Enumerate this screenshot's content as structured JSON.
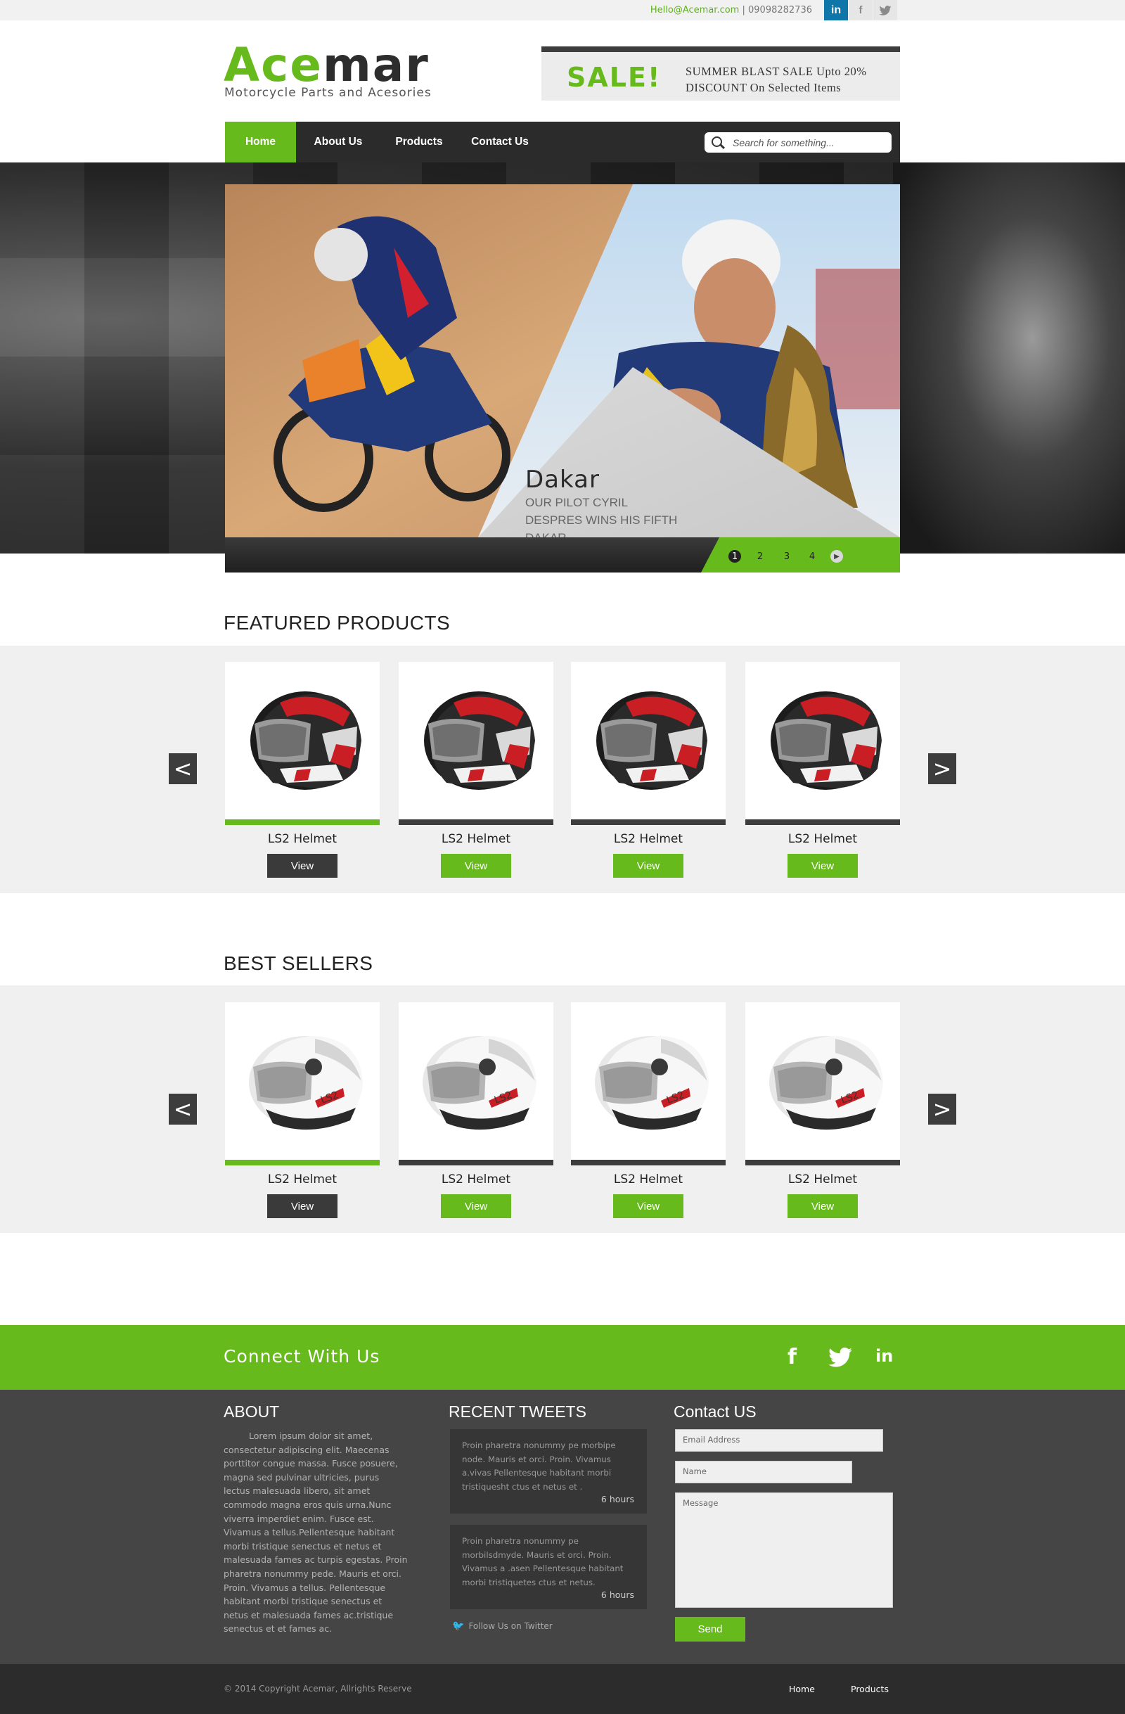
{
  "topbar": {
    "email": "Hello@Acemar.com",
    "separator": " | ",
    "phone": "09098282736",
    "social": [
      "linkedin-icon",
      "facebook-icon",
      "twitter-icon"
    ]
  },
  "brand": {
    "logo_green": "Ace",
    "logo_dark": "mar",
    "tagline": "Motorcycle Parts and Acesories",
    "accent_color": "#67ba1b"
  },
  "promo": {
    "label": "SALE!",
    "text": "SUMMER BLAST SALE Upto 20% DISCOUNT On Selected Items"
  },
  "nav": {
    "items": [
      {
        "label": "Home",
        "active": true
      },
      {
        "label": "About Us",
        "active": false
      },
      {
        "label": "Products",
        "active": false
      },
      {
        "label": "Contact Us",
        "active": false
      }
    ],
    "search_placeholder": "Search for something..."
  },
  "slider": {
    "title": "Dakar",
    "subtitle": "OUR PILOT CYRIL DESPRES WINS HIS FIFTH DAKAR",
    "pages": [
      "1",
      "2",
      "3",
      "4"
    ],
    "active_page": "1"
  },
  "featured": {
    "title": "FEATURED PRODUCTS",
    "products": [
      {
        "name": "LS2 Helmet",
        "button": "View"
      },
      {
        "name": "LS2 Helmet",
        "button": "View"
      },
      {
        "name": "LS2 Helmet",
        "button": "View"
      },
      {
        "name": "LS2 Helmet",
        "button": "View"
      }
    ],
    "prev": "<",
    "next": ">"
  },
  "bestsellers": {
    "title": "BEST SELLERS",
    "products": [
      {
        "name": "LS2 Helmet",
        "button": "View"
      },
      {
        "name": "LS2 Helmet",
        "button": "View"
      },
      {
        "name": "LS2 Helmet",
        "button": "View"
      },
      {
        "name": "LS2 Helmet",
        "button": "View"
      }
    ],
    "prev": "<",
    "next": ">"
  },
  "connect": {
    "title": "Connect With Us",
    "icons": [
      "facebook-icon",
      "twitter-icon",
      "linkedin-icon"
    ]
  },
  "footer": {
    "about_title": "ABOUT",
    "about_text": "Lorem ipsum dolor sit amet, consectetur adipiscing elit. Maecenas porttitor congue massa. Fusce posuere, magna sed pulvinar ultricies, purus lectus malesuada libero, sit amet commodo magna eros quis urna.Nunc viverra imperdiet enim. Fusce est. Vivamus a tellus.Pellentesque habitant morbi tristique senectus et netus et malesuada fames ac turpis egestas. Proin pharetra nonummy pede. Mauris et orci. Proin. Vivamus a tellus. Pellentesque habitant morbi tristique senectus et netus et malesuada fames ac.tristique senectus et et fames ac.",
    "tweets_title": "RECENT TWEETS",
    "tweets": [
      {
        "text": "Proin pharetra nonummy pe morbipe node. Mauris et orci. Proin. Vivamus a.vivas Pellentesque habitant morbi tristiquesht ctus et netus et .",
        "time": "6 hours"
      },
      {
        "text": "Proin pharetra nonummy pe morbilsdmyde. Mauris et orci. Proin. Vivamus a .asen Pellentesque habitant morbi tristiquetes ctus et netus.",
        "time": "6 hours"
      }
    ],
    "follow": "Follow Us on Twitter",
    "contact_title": "Contact US",
    "email_placeholder": "Email Address",
    "name_placeholder": "Name",
    "message_placeholder": "Message",
    "send": "Send"
  },
  "bottom": {
    "copyright": "© 2014 Copyright Acemar, Allrights Reserve",
    "links": [
      "Home",
      "Products"
    ]
  }
}
